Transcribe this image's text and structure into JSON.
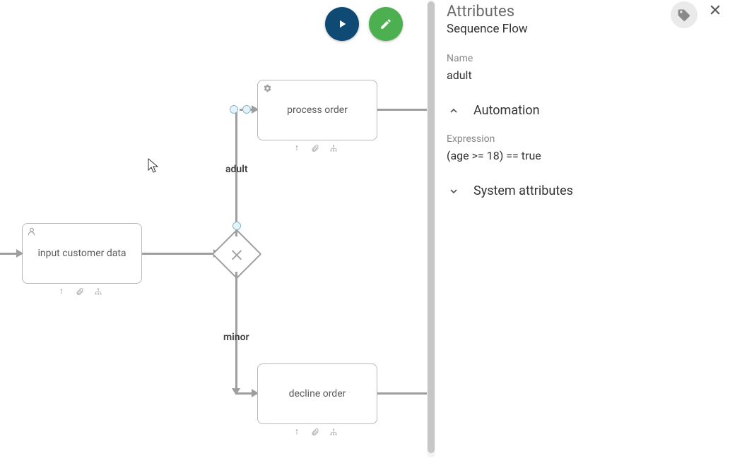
{
  "canvas": {
    "nodes": {
      "input_customer": {
        "label": "input customer data"
      },
      "process_order": {
        "label": "process order"
      },
      "decline_order": {
        "label": "decline order"
      }
    },
    "flows": {
      "adult": {
        "label": "adult"
      },
      "minor": {
        "label": "minor"
      }
    },
    "action_buttons": {
      "play": "play",
      "edit": "edit"
    }
  },
  "panel": {
    "title": "Attributes",
    "subtitle": "Sequence Flow",
    "name_label": "Name",
    "name_value": "adult",
    "sections": {
      "automation": {
        "title": "Automation",
        "expanded": true,
        "expression_label": "Expression",
        "expression_value": "(age >= 18) == true"
      },
      "system_attributes": {
        "title": "System attributes",
        "expanded": false
      }
    }
  },
  "colors": {
    "play_button": "#0e4a73",
    "edit_button": "#4caf50",
    "node_border": "#b8b8b8",
    "connector": "#9e9e9e"
  }
}
